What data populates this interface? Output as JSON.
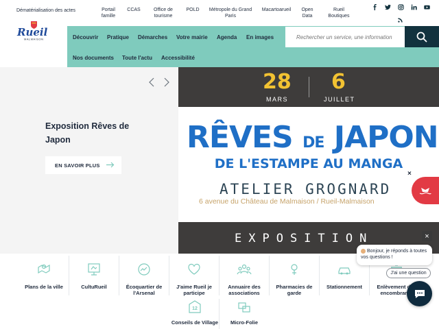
{
  "header": {
    "utility_links": [
      {
        "label": "Dématérialisation des actes"
      },
      {
        "label": "Portail famille"
      },
      {
        "label": "CCAS"
      },
      {
        "label": "Office de tourisme"
      },
      {
        "label": "POLD"
      },
      {
        "label": "Métropole du Grand Paris"
      },
      {
        "label": "Macartoarueil"
      },
      {
        "label": "Open Data"
      },
      {
        "label": "Rueil Boutiques"
      }
    ],
    "social_icons": [
      "facebook-icon",
      "twitter-icon",
      "instagram-icon",
      "linkedin-icon",
      "youtube-icon",
      "rss-icon"
    ],
    "logo": {
      "name": "Rueil",
      "sub": "MALMAISON"
    }
  },
  "nav": {
    "items": [
      {
        "label": "Découvrir"
      },
      {
        "label": "Pratique"
      },
      {
        "label": "Démarches"
      },
      {
        "label": "Votre mairie"
      },
      {
        "label": "Agenda"
      },
      {
        "label": "En images"
      },
      {
        "label": "Nos documents"
      },
      {
        "label": "Toute l'actu"
      },
      {
        "label": "Accessibilité"
      }
    ],
    "search_placeholder": "Rechercher un service, une information"
  },
  "hero": {
    "title": "Exposition Rêves de Japon",
    "button": "EN SAVOIR PLUS",
    "poster": {
      "day1": "28",
      "month1": "MARS",
      "day2": "6",
      "month2": "JUILLET",
      "title_a": "RÊVES",
      "title_de": "DE",
      "title_b": "JAPON",
      "subtitle": "DE L'ESTAMPE AU MANGA",
      "atelier": "ATELIER GROGNARD",
      "address": "6 avenue du Château de Malmaison / Rueil-Malmaison",
      "footer": "EXPOSITION"
    },
    "close": "×"
  },
  "quick_access": [
    {
      "label": "Plans de la ville",
      "icon": "map-icon"
    },
    {
      "label": "CultuRueil",
      "icon": "culture-icon"
    },
    {
      "label": "Écoquartier de l'Arsenal",
      "icon": "eco-district-icon"
    },
    {
      "label": "J'aime Rueil je participe",
      "icon": "heart-icon"
    },
    {
      "label": "Annuaire des associations",
      "icon": "associations-icon"
    },
    {
      "label": "Pharmacies de garde",
      "icon": "pharmacy-icon"
    },
    {
      "label": "Stationnement",
      "icon": "car-icon"
    },
    {
      "label": "Enlèvement des encombrants",
      "icon": "bulky-waste-icon"
    },
    {
      "label": "Conseils de Village",
      "icon": "village-council-icon"
    },
    {
      "label": "Micro-Folie",
      "icon": "micro-folie-icon"
    }
  ],
  "chat": {
    "message": "Bonjour, je réponds à toutes vos questions !",
    "question_button": "J'ai une question",
    "close": "×"
  },
  "colors": {
    "nav_bg": "#7fcbbd",
    "dark": "#12323e",
    "poster_blue": "#1f6fc6",
    "date_yellow": "#f2c232",
    "badge_red": "#e23a44"
  }
}
